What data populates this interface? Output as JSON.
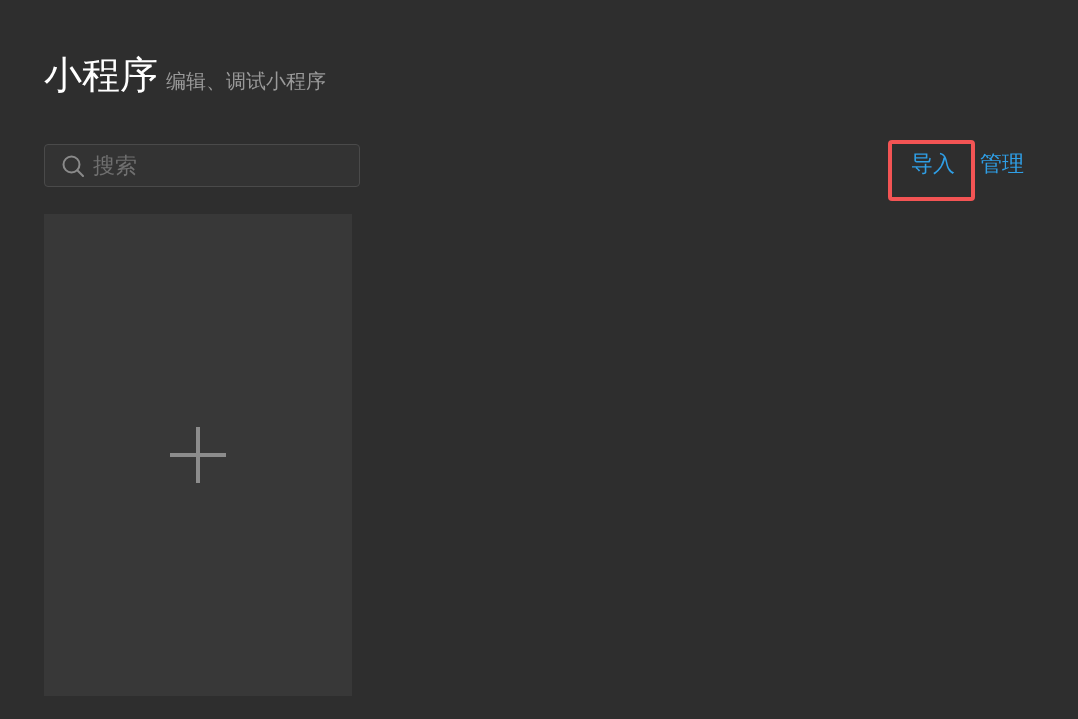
{
  "header": {
    "title": "小程序",
    "subtitle": "编辑、调试小程序"
  },
  "search": {
    "placeholder": "搜索"
  },
  "actions": [
    {
      "label": "导入",
      "highlighted": true
    },
    {
      "label": "管理",
      "highlighted": false
    }
  ],
  "cards": [
    {
      "kind": "add"
    }
  ]
}
